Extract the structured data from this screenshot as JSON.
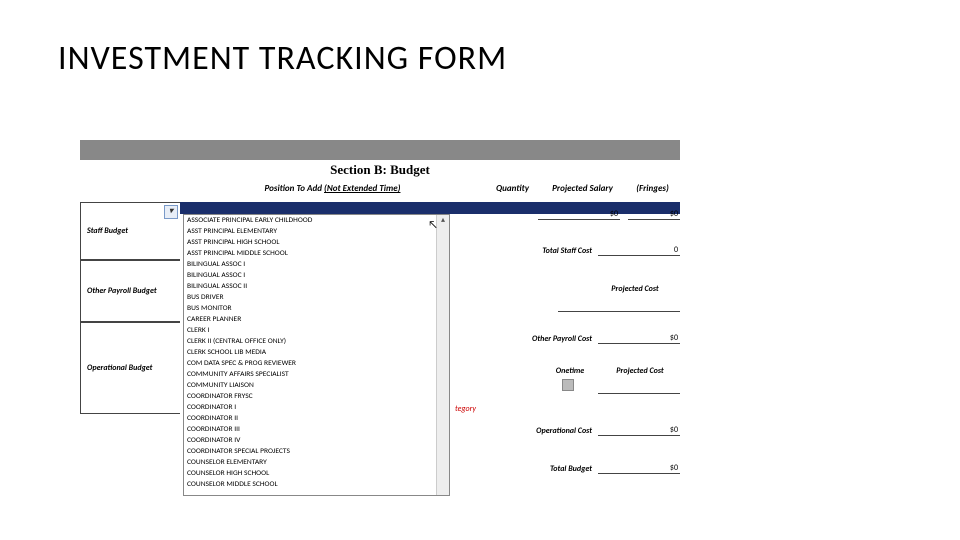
{
  "title": "INVESTMENT TRACKING FORM",
  "section_bar_title": "Section B: Budget",
  "headers": {
    "position": "Position To Add",
    "position_suffix": "(Not Extended Time)",
    "quantity": "Quantity",
    "projected_salary": "Projected Salary",
    "fringes": "(Fringes)"
  },
  "left_labels": {
    "staff": "Staff Budget",
    "other_payroll": "Other Payroll Budget",
    "operational": "Operational Budget"
  },
  "dropdown_items": [
    "ASSOCIATE PRINCIPAL EARLY CHILDHOOD",
    "ASST PRINCIPAL ELEMENTARY",
    "ASST PRINCIPAL HIGH SCHOOL",
    "ASST PRINCIPAL MIDDLE SCHOOL",
    "BILINGUAL ASSOC I",
    "BILINGUAL ASSOC I",
    "BILINGUAL ASSOC II",
    "BUS DRIVER",
    "BUS MONITOR",
    "CAREER PLANNER",
    "CLERK I",
    "CLERK II (CENTRAL OFFICE ONLY)",
    "CLERK SCHOOL LIB MEDIA",
    "COM DATA SPEC & PROG REVIEWER",
    "COMMUNITY AFFAIRS SPECIALIST",
    "COMMUNITY LIAISON",
    "COORDINATOR FRYSC",
    "COORDINATOR I",
    "COORDINATOR II",
    "COORDINATOR III",
    "COORDINATOR IV",
    "COORDINATOR SPECIAL PROJECTS",
    "COUNSELOR ELEMENTARY",
    "COUNSELOR HIGH SCHOOL",
    "COUNSELOR MIDDLE SCHOOL"
  ],
  "right": {
    "initial_salary": "$0",
    "initial_fringes": "$0",
    "total_staff_label": "Total Staff Cost",
    "total_staff_val": "0",
    "projected_cost_hdr": "Projected Cost",
    "other_payroll_label": "Other Payroll Cost",
    "other_payroll_val": "$0",
    "onetime_hdr": "Onetime",
    "projected_cost_hdr2": "Projected Cost",
    "tegory": "tegory",
    "operational_label": "Operational Cost",
    "operational_val": "$0",
    "total_budget_label": "Total Budget",
    "total_budget_val": "$0"
  },
  "glyphs": {
    "dropdown_arrow": "▾",
    "scroll_up": "▴",
    "scroll_down": "▾",
    "cursor": "↖"
  }
}
